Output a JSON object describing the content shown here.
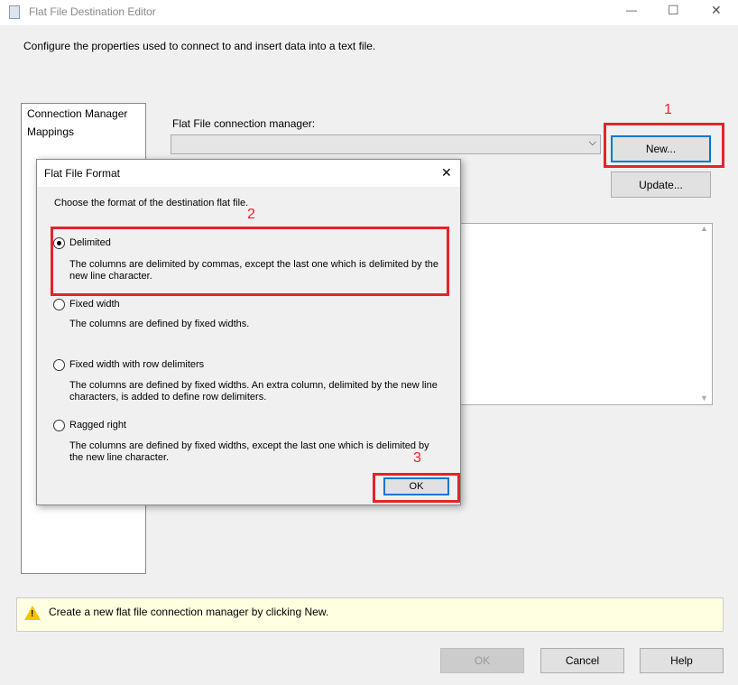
{
  "window": {
    "title": "Flat File Destination Editor",
    "minimize": "—",
    "maximize": "☐",
    "close": "✕"
  },
  "description": "Configure the properties used to connect to and insert data into a text file.",
  "nav": {
    "items": [
      {
        "label": "Connection Manager"
      },
      {
        "label": "Mappings"
      }
    ]
  },
  "connection": {
    "label": "Flat File connection manager:",
    "value": "",
    "new_label": "New...",
    "update_label": "Update..."
  },
  "dialog": {
    "title": "Flat File Format",
    "close": "✕",
    "prompt": "Choose the format of the destination flat file.",
    "options": [
      {
        "label": "Delimited",
        "desc": "The columns are delimited by commas, except the last one which is delimited by the new line character.",
        "selected": true
      },
      {
        "label": "Fixed width",
        "desc": "The columns are defined by fixed widths.",
        "selected": false
      },
      {
        "label": "Fixed width with row delimiters",
        "desc": "The columns are defined by fixed widths. An extra column, delimited by the new line characters, is added to define row delimiters.",
        "selected": false
      },
      {
        "label": "Ragged right",
        "desc": "The columns are defined by fixed widths, except the last one which is delimited by the new line character.",
        "selected": false
      }
    ],
    "ok_label": "OK"
  },
  "annotations": {
    "step1": "1",
    "step2": "2",
    "step3": "3",
    "color": "#e3242b"
  },
  "status": {
    "message": "Create a new flat file connection manager by clicking New."
  },
  "footer": {
    "ok_label": "OK",
    "cancel_label": "Cancel",
    "help_label": "Help"
  }
}
